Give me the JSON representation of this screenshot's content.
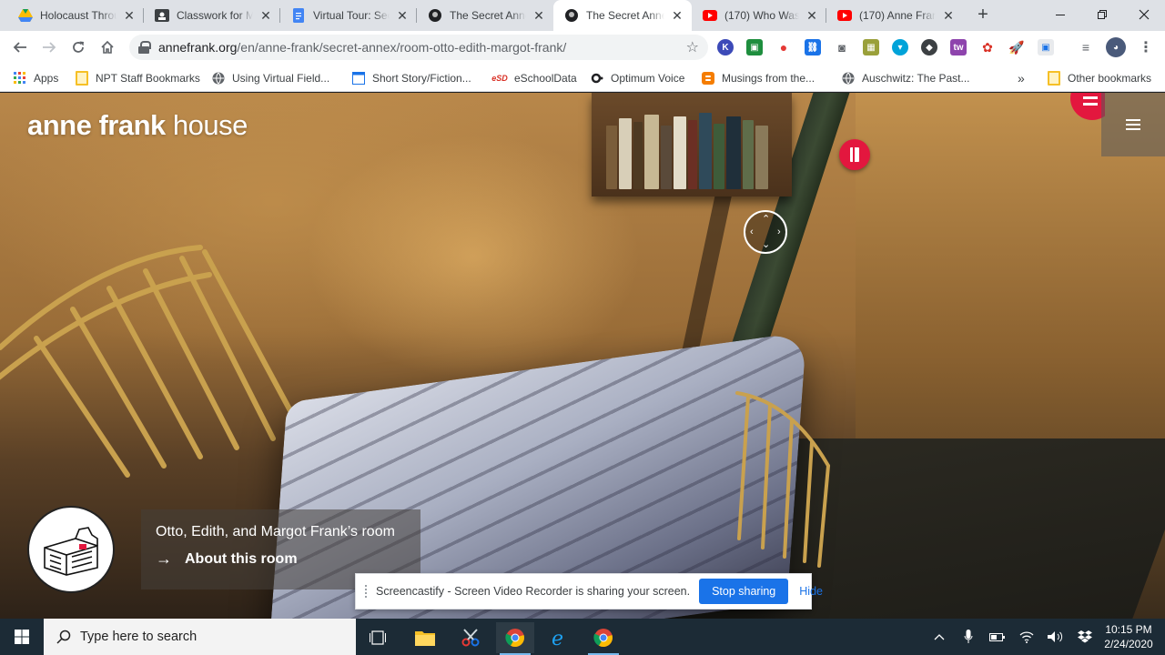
{
  "tabs": [
    {
      "title": "Holocaust Throu",
      "favicon": "google-drive-icon",
      "active": false
    },
    {
      "title": "Classwork for M",
      "favicon": "google-classroom-icon",
      "active": false
    },
    {
      "title": "Virtual Tour: Sec",
      "favicon": "google-docs-icon",
      "active": false
    },
    {
      "title": "The Secret Anne",
      "favicon": "anne-frank-icon",
      "active": false
    },
    {
      "title": "The Secret Anne",
      "favicon": "anne-frank-icon",
      "active": true
    },
    {
      "title": "(170) Who Was",
      "favicon": "youtube-icon",
      "active": false
    },
    {
      "title": "(170) Anne Fran",
      "favicon": "youtube-icon",
      "active": false
    }
  ],
  "address": {
    "host": "annefrank.org",
    "path": "/en/anne-frank/secret-annex/room-otto-edith-margot-frank/"
  },
  "bookmarks": [
    {
      "label": "Apps",
      "icon": "apps-grid-icon"
    },
    {
      "label": "NPT Staff Bookmarks",
      "icon": "folder-icon"
    },
    {
      "label": "Using Virtual Field...",
      "icon": "globe-icon"
    },
    {
      "label": "Short Story/Fiction...",
      "icon": "doc-icon"
    },
    {
      "label": "eSchoolData",
      "icon": "esd-icon"
    },
    {
      "label": "Optimum Voice",
      "icon": "optimum-icon"
    },
    {
      "label": "Musings from the...",
      "icon": "blogger-icon"
    },
    {
      "label": "Auschwitz: The Past...",
      "icon": "globe-icon"
    }
  ],
  "bookmarks_overflow": "»",
  "other_bookmarks": "Other bookmarks",
  "site": {
    "brand_bold": "anne frank",
    "brand_light": "house",
    "room_name": "Otto, Edith, and Margot Frank’s room",
    "about_label": "About this room"
  },
  "share_bar": {
    "message": "Screencastify - Screen Video Recorder is sharing your screen.",
    "stop_label": "Stop sharing",
    "hide_label": "Hide"
  },
  "taskbar": {
    "search_placeholder": "Type here to search",
    "time": "10:15 PM",
    "date": "2/24/2020"
  },
  "colors": {
    "accent_red": "#e3173e",
    "chrome_blue": "#1a73e8",
    "taskbar": "#1c2b36"
  }
}
